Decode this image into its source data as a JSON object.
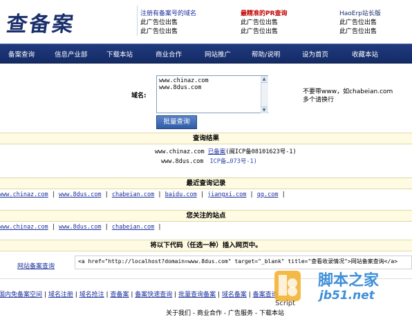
{
  "logo": {
    "text": "查备案"
  },
  "ads": {
    "row1": [
      "注册有备案号的域名",
      "最精准的PR查询",
      "HaoErp站长版"
    ],
    "row2": [
      "此广告位出售",
      "此广告位出售",
      "此广告位出售"
    ],
    "row3": [
      "此广告位出售",
      "此广告位出售",
      "此广告位出售"
    ]
  },
  "nav": {
    "items": [
      "备案查询",
      "信息产业部",
      "下载本站",
      "商业合作",
      "网站推广",
      "帮助/说明",
      "设为首页",
      "收藏本站"
    ]
  },
  "form": {
    "domain_label": "域名:",
    "textarea_value": "www.chinaz.com\nwww.8dus.com",
    "submit_label": "批量查询",
    "hint_line1": "不要带www，如chabeian.com",
    "hint_line2": "多个请换行"
  },
  "results": {
    "title": "查询结果",
    "rows": [
      {
        "domain": "www.chinaz.com",
        "status": "已备案",
        "record": "(闽ICP备08101623号-1)"
      },
      {
        "domain": "www.8dus.com",
        "status": "",
        "record": "ICP备…073号-1)"
      }
    ]
  },
  "recent": {
    "title": "最近查询记录",
    "links": [
      "www.chinaz.com",
      "www.8dus.com",
      "chabeian.com",
      "baidu.com",
      "jiangxi.com",
      "qq.com"
    ]
  },
  "watched": {
    "title": "您关注的站点",
    "links": [
      "www.chinaz.com",
      "www.8dus.com",
      "chabeian.com"
    ]
  },
  "embed": {
    "title": "将以下代码（任选一种）插入网页中。",
    "label": "网站备案查询",
    "code": "<a href=\"http://localhost?domain=www.8dus.com\" target=\"_blank\" title=\"查看收录情况\">网站备案查询</a>"
  },
  "footer_links": [
    "国内免备案空间",
    "域名注册",
    "域名抢注",
    "查备案",
    "备案快速查询",
    "批量查询备案",
    "域名备案",
    "备案查询"
  ],
  "footer_bottom": [
    "关于我们",
    "商业合作",
    "广告服务",
    "下载本站"
  ],
  "watermark": {
    "brand": "脚本之家",
    "url": "jb51.net",
    "tag": "Script"
  },
  "colors": {
    "nav_bg": "#1b3473",
    "link": "#1b2f9b",
    "section_bg": "#fffbe3",
    "ad_red": "#c00000"
  }
}
